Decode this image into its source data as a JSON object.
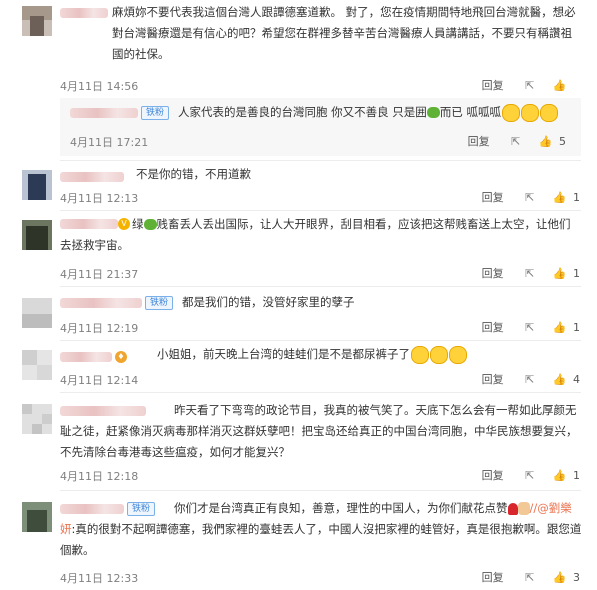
{
  "comments": [
    {
      "text": "麻煩妳不要代表我這個台灣人跟譚德塞道歉。 對了，您在疫情期間特地飛回台灣就醫，想必對台灣醫療還是有信心的吧？希望您在群裡多替辛苦台灣醫療人員講講話，不要只有稱讚祖國的社保。",
      "date": "4月11日 14:56",
      "reply_label": "回复",
      "like_count": "",
      "sub_reply": {
        "badge": "铁粉",
        "text": "人家代表的是善良的台灣同胞 你又不善良 只是囲",
        "text_tail": "而已 呱呱呱",
        "date": "4月11日 17:21",
        "reply_label": "回复",
        "like_count": "5"
      }
    },
    {
      "text": "不是你的错，不用道歉",
      "date": "4月11日 12:13",
      "reply_label": "回复",
      "like_count": "1"
    },
    {
      "text": "绿",
      "text_tail": "贱畜丢人丢出国际，让人大开眼界，刮目相看，应该把这帮贱畜送上太空，让他们去拯救宇宙。",
      "date": "4月11日 21:37",
      "reply_label": "回复",
      "like_count": "1"
    },
    {
      "badge": "铁粉",
      "text": "都是我们的错，没管好家里的孽子",
      "date": "4月11日 12:19",
      "reply_label": "回复",
      "like_count": "1"
    },
    {
      "text": "小姐姐，前天晚上台湾的蛙蛙们是不是都尿裤子了",
      "date": "4月11日 12:14",
      "reply_label": "回复",
      "like_count": "4"
    },
    {
      "text": "昨天看了下弯弯的政论节目，我真的被气笑了。天底下怎么会有一帮如此厚颜无耻之徒，赶紧像消灭病毒那样消灭这群妖孽吧！把宝岛还给真正的中国台湾同胞，中华民族想要复兴，不先清除台毒港毒这些瘟疫，如何才能复兴？",
      "date": "4月11日 12:18",
      "reply_label": "回复",
      "like_count": "1"
    },
    {
      "badge": "铁粉",
      "text": "你们才是台湾真正有良知，善意，理性的中国人，为你们献花点赞",
      "mention": "//@劉樂妍",
      "text2": ":真的很對不起啊譚德塞，我們家裡的臺蛙丟人了，中國人沒把家裡的蛙管好，真是很抱歉啊。跟您道個歉。",
      "date": "4月11日 12:33",
      "reply_label": "回复",
      "like_count": "3"
    }
  ],
  "colors": {
    "mention": "#eb7350",
    "badge": "#3f86d8",
    "meta": "#808080"
  },
  "icons": [
    "share-icon",
    "like-icon",
    "frog-emoji",
    "laugh-emoji",
    "rose-emoji",
    "hands-emoji",
    "vip-icon"
  ]
}
